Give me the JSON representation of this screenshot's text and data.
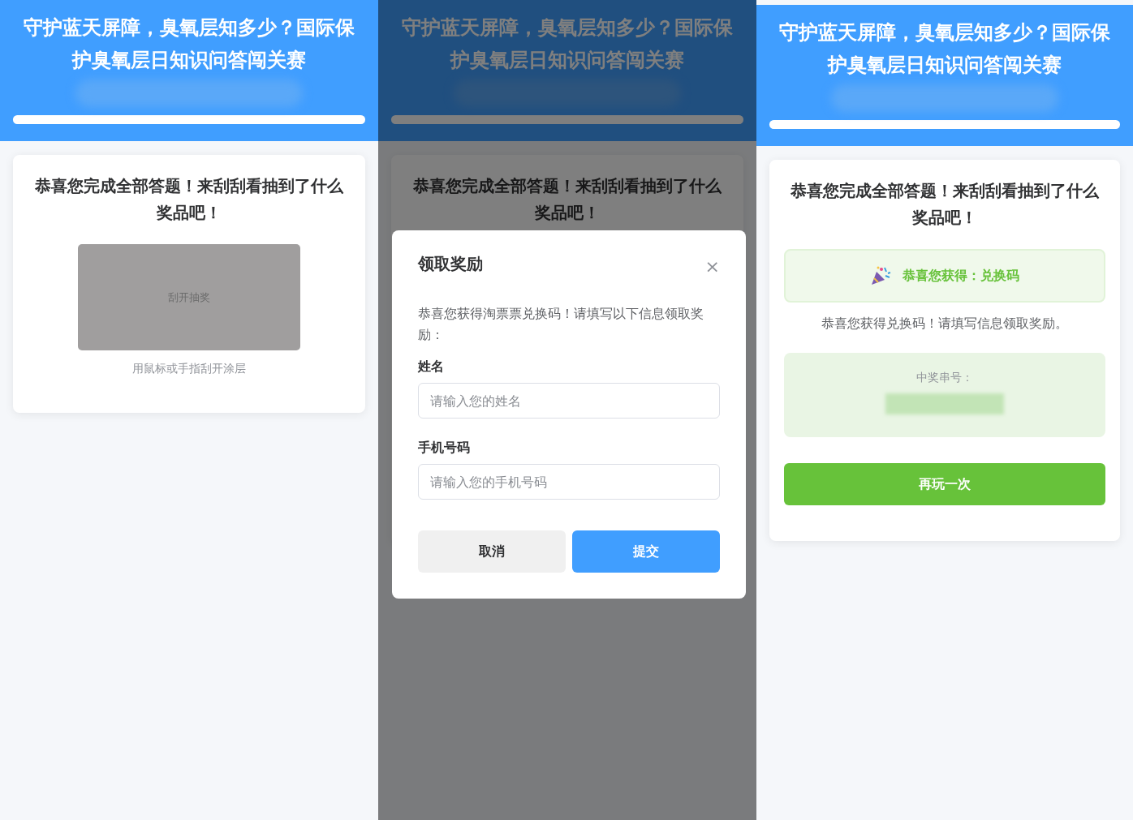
{
  "screens": [
    {
      "kind": "scratch",
      "dimmed": false,
      "header": {
        "title": "守护蓝天屏障，臭氧层知多少？国际保护臭氧层日知识问答闯关赛"
      },
      "progress": {
        "level": 1
      },
      "card": {
        "heading": "恭喜您完成全部答题！来刮刮看抽到了什么奖品吧！",
        "scratch_label": "刮开抽奖",
        "hint": "用鼠标或手指刮开涂层"
      }
    },
    {
      "kind": "dialog",
      "dimmed": true,
      "header": {
        "title": "守护蓝天屏障，臭氧层知多少？国际保护臭氧层日知识问答闯关赛"
      },
      "progress": {
        "level": 1
      },
      "card": {
        "heading": "恭喜您完成全部答题！来刮刮看抽到了什么奖品吧！"
      },
      "dialog": {
        "title": "领取奖励",
        "close": "×",
        "message": "恭喜您获得淘票票兑换码！请填写以下信息领取奖励：",
        "fields": [
          {
            "label": "姓名",
            "placeholder": "请输入您的姓名"
          },
          {
            "label": "手机号码",
            "placeholder": "请输入您的手机号码"
          }
        ],
        "buttons": [
          {
            "label": "取消",
            "kind": "secondary"
          },
          {
            "label": "提交",
            "kind": "primary"
          }
        ]
      }
    },
    {
      "kind": "result",
      "dimmed": false,
      "header": {
        "title": "守护蓝天屏障，臭氧层知多少？国际保护臭氧层日知识问答闯关赛"
      },
      "progress": {
        "level": 1
      },
      "card": {
        "heading": "恭喜您完成全部答题！来刮刮看抽到了什么奖品吧！",
        "banner": "恭喜您获得：兑换码",
        "message": "恭喜您获得兑换码！请填写信息领取奖励。",
        "serial_label": "中奖串号：",
        "replay_button": "再玩一次"
      }
    }
  ]
}
